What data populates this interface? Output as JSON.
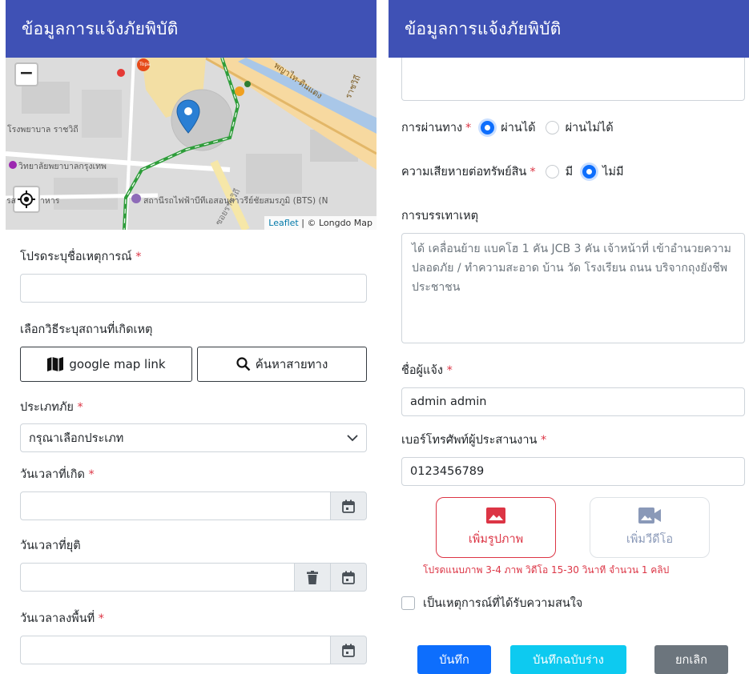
{
  "left": {
    "title": "ข้อมูลการแจ้งภัยพิบัติ",
    "map": {
      "zoom_out": "−",
      "labels": {
        "hospital": "โรงพยาบาล ราชวิถี",
        "college": "วิทยาลัยพยาบาลกรุงเทพ",
        "station": "สถานีรถไฟฟ้าบีทีเอสอนุสาวรีย์ชัยสมรภูมิ (BTS) (N",
        "road_1": "พญาไท-ดินแดง",
        "road_2": "ราชวิถี",
        "road_3": "ซอยราชวิถี",
        "restaurant": "รส",
        "restaurant_2": "าหาร",
        "topa": "Topa"
      },
      "attribution_leaflet": "Leaflet",
      "attribution_rest": " | © Longdo Map"
    },
    "event_name_label": "โปรดระบุชื่อเหตุการณ์",
    "event_name_value": "",
    "location_method_label": "เลือกวิธีระบุสถานที่เกิดเหตุ",
    "google_map_button": "google map link",
    "search_route_button": "ค้นหาสายทาง",
    "disaster_type_label": "ประเภทภัย",
    "disaster_type_value": "กรุณาเลือกประเภท",
    "start_datetime_label": "วันเวลาที่เกิด",
    "end_datetime_label": "วันเวลาที่ยุติ",
    "onsite_datetime_label": "วันเวลาลงพื้นที่",
    "required_mark": "*"
  },
  "right": {
    "title": "ข้อมูลการแจ้งภัยพิบัติ",
    "passable_label": "การผ่านทาง",
    "passable_yes": "ผ่านได้",
    "passable_no": "ผ่านไม่ได้",
    "passable_selected": "yes",
    "property_damage_label": "ความเสียหายต่อทรัพย์สิน",
    "property_damage_yes": "มี",
    "property_damage_no": "ไม่มี",
    "property_damage_selected": "no",
    "description_label": "การบรรเทาเหตุ",
    "description_value": "ได้ เคลื่อนย้าย แบคโฮ 1 คัน JCB 3 คัน เจ้าหน้าที่ เข้าอำนวยความปลอดภัย / ทำความสะอาด บ้าน วัด โรงเรียน ถนน บริจากถุงยังชีพประชาชน",
    "reporter_label": "ชื่อผู้แจ้ง",
    "reporter_value": "admin admin",
    "phone_label": "เบอร์โทรศัพท์ผู้ประสานงาน",
    "phone_value": "0123456789",
    "add_photo": "เพิ่มรูปภาพ",
    "add_video": "เพิ่มวีดีโอ",
    "media_note": "โปรดแนบภาพ 3-4 ภาพ วิดีโอ 15-30 วินาที จำนวน 1 คลิป",
    "interest_checkbox": "เป็นเหตุการณ์ที่ได้รับความสนใจ",
    "save_button": "บันทึก",
    "save_draft_button": "บันทึกฉบับร่าง",
    "cancel_button": "ยกเลิก",
    "required_mark": "*"
  },
  "colors": {
    "appbar": "#3f51b5",
    "primary": "#0d6efd",
    "info": "#0dcaf0",
    "secondary": "#6c757d",
    "danger": "#dc3545"
  }
}
